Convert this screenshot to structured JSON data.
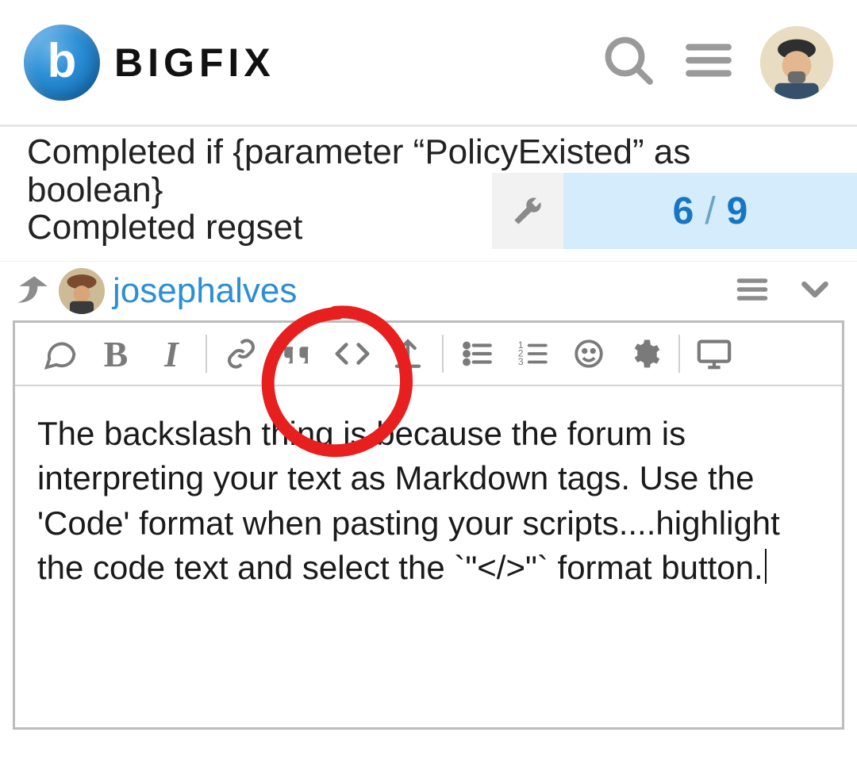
{
  "header": {
    "brand": "BIGFIX",
    "logo_letter": "b"
  },
  "thread": {
    "line1": "Completed if {parameter “PolicyExisted” as boolean}",
    "line2_partial": "Completed regset"
  },
  "pager": {
    "current": "6",
    "separator": "/",
    "total": "9"
  },
  "reply": {
    "username": "josephalves"
  },
  "editor": {
    "text_1": "The backslash thing is because the forum is interpreting your text as Markdown tags.  Use the 'Code' format when pasting your scripts....highlight the code text and select the `\"</>\"` format button."
  },
  "toolbar": {
    "bold": "B",
    "italic": "I"
  }
}
